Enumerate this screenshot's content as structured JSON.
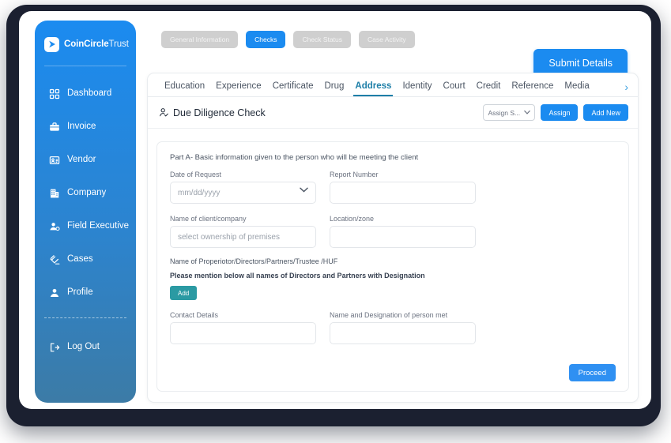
{
  "brand": {
    "name_bold": "CoinCircle",
    "name_light": "Trust",
    "logo_icon": "play-arrow-icon"
  },
  "sidebar": {
    "items": [
      {
        "label": "Dashboard",
        "icon": "grid-icon"
      },
      {
        "label": "Invoice",
        "icon": "briefcase-icon"
      },
      {
        "label": "Vendor",
        "icon": "id-card-icon"
      },
      {
        "label": "Company",
        "icon": "building-icon"
      },
      {
        "label": "Field Executive",
        "icon": "user-settings-icon"
      },
      {
        "label": "Cases",
        "icon": "gavel-icon"
      },
      {
        "label": "Profile",
        "icon": "user-icon"
      }
    ],
    "logout": {
      "label": "Log Out",
      "icon": "logout-icon"
    }
  },
  "top_tabs": [
    {
      "label": "General Information",
      "active": false
    },
    {
      "label": "Checks",
      "active": true
    },
    {
      "label": "Check Status",
      "active": false
    },
    {
      "label": "Case Activity",
      "active": false
    }
  ],
  "submit_button": {
    "label": "Submit Details"
  },
  "subtabs": {
    "items": [
      {
        "label": "Education",
        "active": false
      },
      {
        "label": "Experience",
        "active": false
      },
      {
        "label": "Certificate",
        "active": false
      },
      {
        "label": "Drug",
        "active": false
      },
      {
        "label": "Address",
        "active": true
      },
      {
        "label": "Identity",
        "active": false
      },
      {
        "label": "Court",
        "active": false
      },
      {
        "label": "Credit",
        "active": false
      },
      {
        "label": "Reference",
        "active": false
      },
      {
        "label": "Media",
        "active": false
      }
    ],
    "next_arrow": "›"
  },
  "panel": {
    "title": "Due Diligence Check",
    "title_icon": "user-check-icon",
    "assign_select": {
      "value": "Assign S...",
      "caret": "⌄"
    },
    "assign_button": "Assign",
    "add_new_button": "Add New"
  },
  "form": {
    "part_title": "Part A- Basic information given to the person who will be meeting the client",
    "fields": {
      "date_of_request": {
        "label": "Date of Request",
        "placeholder": "mm/dd/yyyy",
        "value": ""
      },
      "report_number": {
        "label": "Report Number",
        "placeholder": "",
        "value": ""
      },
      "name_of_client": {
        "label": "Name of client/company",
        "placeholder": "select ownership of premises",
        "value": ""
      },
      "location_zone": {
        "label": "Location/zone",
        "placeholder": "",
        "value": ""
      },
      "contact_details": {
        "label": "Contact Details",
        "placeholder": "",
        "value": ""
      },
      "person_met": {
        "label": "Name and Designation of person met",
        "placeholder": "",
        "value": ""
      }
    },
    "note_1": "Name of  Properiotor/Directors/Partners/Trustee /HUF",
    "note_2": "Please mention below all names of Directors and Partners  with Designation",
    "add_button": "Add",
    "proceed_button": "Proceed"
  },
  "colors": {
    "accent_blue": "#1b8bf0",
    "teal": "#2b9aa3",
    "active_tab_underline": "#1e7fa8",
    "frame_dark": "#1b2030"
  }
}
